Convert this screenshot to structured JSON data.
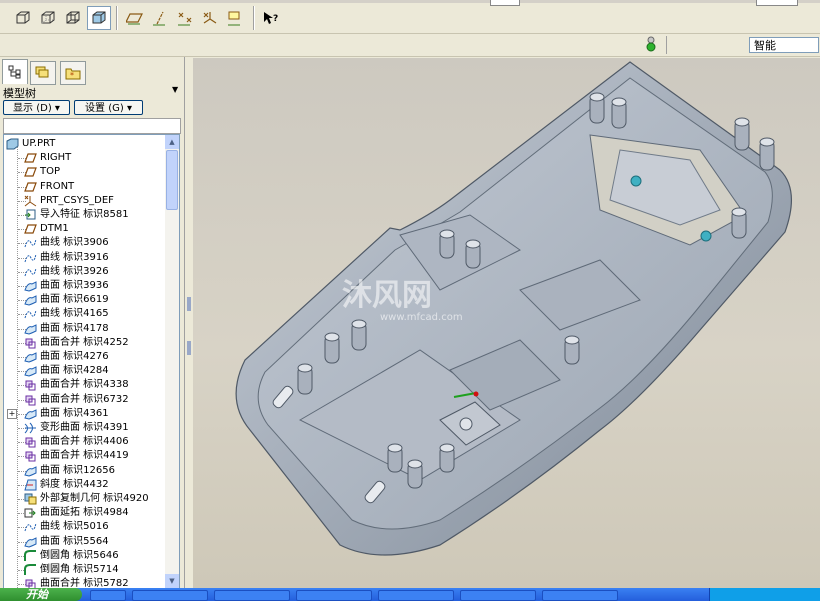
{
  "toolbar": {
    "buttons": [
      {
        "icon": "no-hidden-view-icon"
      },
      {
        "icon": "hidden-line-view-icon"
      },
      {
        "icon": "wireframe-view-icon"
      },
      {
        "icon": "shaded-view-icon",
        "active": true
      },
      {
        "icon": "datum-planes-toggle-icon"
      },
      {
        "icon": "datum-axes-toggle-icon"
      },
      {
        "icon": "datum-points-toggle-icon"
      },
      {
        "icon": "coordinate-systems-toggle-icon"
      },
      {
        "icon": "annotation-toggle-icon"
      },
      {
        "icon": "context-help-icon"
      }
    ]
  },
  "filter": {
    "value": "智能"
  },
  "model_tree": {
    "title": "模型树",
    "show_button": "显示 (D)",
    "settings_button": "设置 (G)",
    "tabs": [
      "model-tree-tab",
      "layers-tab",
      "favorites-tab"
    ],
    "nodes": [
      {
        "label": "UP.PRT",
        "icon": "part-icon",
        "level": 0
      },
      {
        "label": "RIGHT",
        "icon": "datum-plane-icon",
        "level": 1
      },
      {
        "label": "TOP",
        "icon": "datum-plane-icon",
        "level": 1
      },
      {
        "label": "FRONT",
        "icon": "datum-plane-icon",
        "level": 1
      },
      {
        "label": "PRT_CSYS_DEF",
        "icon": "csys-icon",
        "level": 1
      },
      {
        "label": "导入特征 标识8581",
        "icon": "import-feature-icon",
        "level": 1
      },
      {
        "label": "DTM1",
        "icon": "datum-plane-icon",
        "level": 1
      },
      {
        "label": "曲线 标识3906",
        "icon": "curve-icon",
        "level": 1
      },
      {
        "label": "曲线 标识3916",
        "icon": "curve-icon",
        "level": 1
      },
      {
        "label": "曲线 标识3926",
        "icon": "curve-icon",
        "level": 1
      },
      {
        "label": "曲面 标识3936",
        "icon": "surface-icon",
        "level": 1
      },
      {
        "label": "曲面 标识6619",
        "icon": "surface-icon",
        "level": 1
      },
      {
        "label": "曲线 标识4165",
        "icon": "curve-icon",
        "level": 1
      },
      {
        "label": "曲面 标识4178",
        "icon": "surface-icon",
        "level": 1
      },
      {
        "label": "曲面合并 标识4252",
        "icon": "merge-icon",
        "level": 1
      },
      {
        "label": "曲面 标识4276",
        "icon": "surface-icon",
        "level": 1
      },
      {
        "label": "曲面 标识4284",
        "icon": "surface-icon",
        "level": 1
      },
      {
        "label": "曲面合并 标识4338",
        "icon": "merge-icon",
        "level": 1
      },
      {
        "label": "曲面合并 标识6732",
        "icon": "merge-icon",
        "level": 1
      },
      {
        "label": "曲面 标识4361",
        "icon": "surface-icon",
        "level": 1,
        "expandable": true
      },
      {
        "label": "变形曲面 标识4391",
        "icon": "warp-surface-icon",
        "level": 1
      },
      {
        "label": "曲面合并 标识4406",
        "icon": "merge-icon",
        "level": 1
      },
      {
        "label": "曲面合并 标识4419",
        "icon": "merge-icon",
        "level": 1
      },
      {
        "label": "曲面 标识12656",
        "icon": "surface-icon",
        "level": 1
      },
      {
        "label": "斜度 标识4432",
        "icon": "draft-icon",
        "level": 1
      },
      {
        "label": "外部复制几何 标识4920",
        "icon": "copy-geometry-icon",
        "level": 1
      },
      {
        "label": "曲面延拓 标识4984",
        "icon": "extend-icon",
        "level": 1
      },
      {
        "label": "曲线 标识5016",
        "icon": "curve-icon",
        "level": 1
      },
      {
        "label": "曲面 标识5564",
        "icon": "surface-icon",
        "level": 1
      },
      {
        "label": "倒圆角 标识5646",
        "icon": "round-icon",
        "level": 1
      },
      {
        "label": "倒圆角 标识5714",
        "icon": "round-icon",
        "level": 1
      },
      {
        "label": "曲面合并 标识5782",
        "icon": "merge-icon",
        "level": 1
      }
    ]
  },
  "viewport": {
    "watermark": "沐风网",
    "watermark_sub": "www.mfcad.com"
  },
  "taskbar": {
    "start_label": "开始"
  },
  "colors": {
    "model": "#b4bcc8",
    "model_dark": "#7d8896",
    "background": "#d4cfc2",
    "accent": "#1e6ad6"
  }
}
